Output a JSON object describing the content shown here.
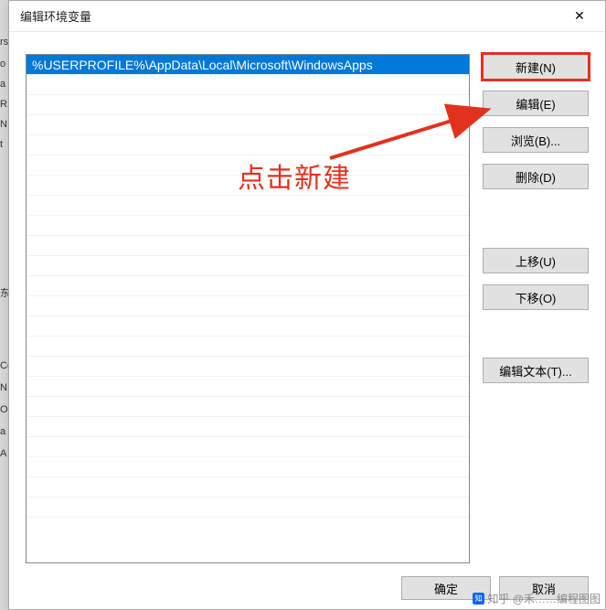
{
  "dialog": {
    "title": "编辑环境变量",
    "close_char": "✕"
  },
  "list": {
    "selected_index": 0,
    "items": [
      "%USERPROFILE%\\AppData\\Local\\Microsoft\\WindowsApps"
    ]
  },
  "buttons": {
    "new": "新建(N)",
    "edit": "编辑(E)",
    "browse": "浏览(B)...",
    "delete": "删除(D)",
    "move_up": "上移(U)",
    "move_down": "下移(O)",
    "edit_text": "编辑文本(T)...",
    "ok": "确定",
    "cancel": "取消"
  },
  "annotation": {
    "text": "点击新建",
    "highlight_target": "new"
  },
  "watermark": {
    "text": "知乎 @禾……编程图图"
  },
  "bg_fragments": [
    "rs",
    "o",
    "a",
    "R",
    "N",
    "t",
    "东",
    "Co",
    "N",
    "O",
    "a",
    "A"
  ]
}
